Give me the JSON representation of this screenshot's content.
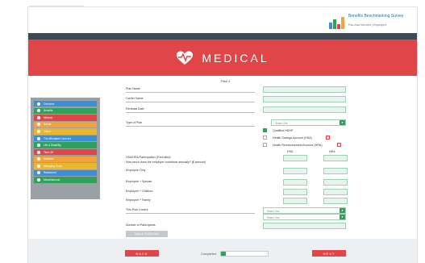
{
  "logo": {
    "title": "Benefits Benchmarking Survey",
    "subtitle": "Pan-Asia Member | Employers"
  },
  "banner": {
    "title": "MEDICAL",
    "icon": "heart-pulse-icon"
  },
  "sidebar": {
    "items": [
      {
        "label": "Overview",
        "color": "#3b8fd6"
      },
      {
        "label": "Benefits",
        "color": "#2fa15a"
      },
      {
        "label": "Medical",
        "color": "#e04648"
      },
      {
        "label": "Dental",
        "color": "#f2a33a"
      },
      {
        "label": "Vision",
        "color": "#e9b62e"
      },
      {
        "label": "The Affordable Care Act",
        "color": "#3b8fd6"
      },
      {
        "label": "Life & Disability",
        "color": "#2fa15a"
      },
      {
        "label": "Time Off",
        "color": "#e04648"
      },
      {
        "label": "Wellness",
        "color": "#f2a33a"
      },
      {
        "label": "Managing Costs",
        "color": "#e9b62e"
      },
      {
        "label": "Retirement",
        "color": "#3b8fd6"
      },
      {
        "label": "Miscellaneous",
        "color": "#2fa15a"
      }
    ]
  },
  "form": {
    "plan_title": "Plan 1",
    "plan_name_label": "Plan Name",
    "carrier_name_label": "Carrier Name",
    "renewal_date_label": "Renewal Date",
    "type_of_plan_label": "Type of Plan",
    "type_of_plan_select": "Select One",
    "option_qualified": "Qualified HDHP",
    "option_hsa": "Health Savings Account (HSA)",
    "option_hra": "Health Reimbursement Account (HRA)",
    "hsa_participation_label": "HSA/HRA Participation (if enrolled)",
    "contribution_question": "How much does the employer contribute annually? ($ amount)",
    "col_hsa": "HSA",
    "col_hra": "HRA",
    "rows": [
      "Employee Only",
      "Employee + Spouse",
      "Employee + Children",
      "Employee + Family"
    ],
    "covers_label": "This Plan Covers",
    "covers_select_1": "Select One",
    "covers_select_2": "Select One",
    "participants_label": "Number of Participants",
    "save_button": "Save & Finish Later"
  },
  "footer": {
    "back_label": "BACK",
    "next_label": "NEXT",
    "completed_label": "Completed",
    "completed_fraction": 0.1
  },
  "colors": {
    "accent_red": "#e04648",
    "accent_green": "#2fa15a",
    "navbar": "#3e4956"
  }
}
